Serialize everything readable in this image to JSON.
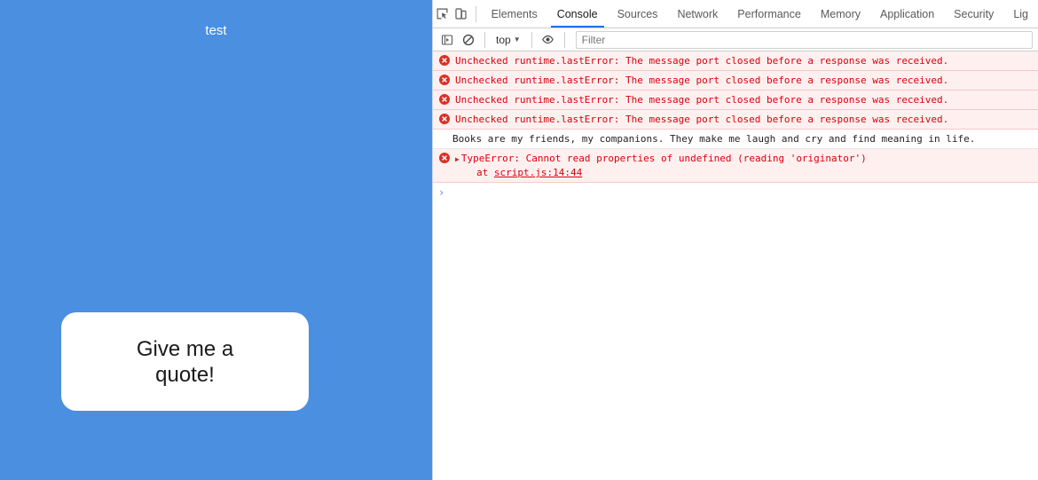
{
  "page": {
    "heading": "test",
    "button_label": "Give me a quote!",
    "background_color": "#4a8fe0",
    "button_color": "#ffffff"
  },
  "devtools": {
    "tabs": [
      {
        "label": "Elements",
        "active": false
      },
      {
        "label": "Console",
        "active": true
      },
      {
        "label": "Sources",
        "active": false
      },
      {
        "label": "Network",
        "active": false
      },
      {
        "label": "Performance",
        "active": false
      },
      {
        "label": "Memory",
        "active": false
      },
      {
        "label": "Application",
        "active": false
      },
      {
        "label": "Security",
        "active": false
      },
      {
        "label": "Lig",
        "active": false
      }
    ],
    "active_tab_color": "#1a73e8",
    "icons": {
      "inspect": "inspect-element-icon",
      "device": "device-toolbar-icon",
      "sidebar": "console-sidebar-icon",
      "clear": "clear-console-icon",
      "eye": "live-expression-icon"
    },
    "toolbar": {
      "context_label": "top",
      "context_caret": "▼",
      "filter_placeholder": "Filter",
      "filter_value": ""
    },
    "console": {
      "messages": [
        {
          "level": "error",
          "text": "Unchecked runtime.lastError: The message port closed before a response was received."
        },
        {
          "level": "error",
          "text": "Unchecked runtime.lastError: The message port closed before a response was received."
        },
        {
          "level": "error",
          "text": "Unchecked runtime.lastError: The message port closed before a response was received."
        },
        {
          "level": "error",
          "text": "Unchecked runtime.lastError: The message port closed before a response was received."
        },
        {
          "level": "log",
          "text": "Books are my friends, my companions. They make me laugh and cry and find meaning in life."
        }
      ],
      "error_entry": {
        "expander": "▶",
        "text": "TypeError: Cannot read properties of undefined (reading 'originator')",
        "stack_prefix": "at ",
        "stack_link": "script.js:14:44"
      },
      "prompt_caret": "›"
    }
  }
}
